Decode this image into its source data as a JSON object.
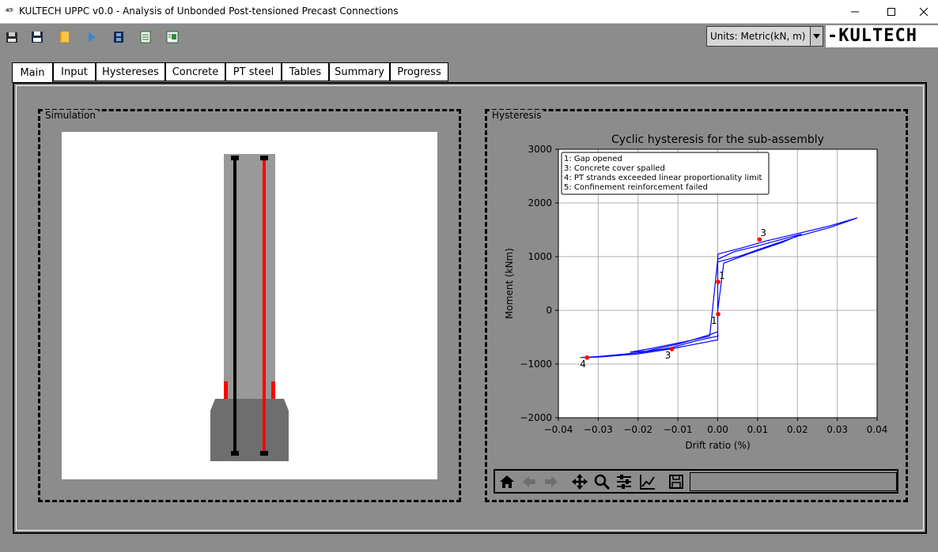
{
  "window": {
    "app_icon": "-KT-",
    "title": "KULTECH UPPC v0.0 - Analysis of Unbonded Post-tensioned Precast Connections",
    "controls": [
      "minimize-icon",
      "maximize-icon",
      "close-icon"
    ]
  },
  "toolbar": {
    "icons": [
      "new-icon",
      "save-icon",
      "open-folder-icon",
      "run-icon",
      "film-icon",
      "report-icon",
      "export-icon"
    ]
  },
  "units": {
    "label": "Units: Metric(kN, m)"
  },
  "logo": {
    "text": "-KULTECH"
  },
  "tabs": [
    {
      "label": "Main"
    },
    {
      "label": "Input"
    },
    {
      "label": "Hystereses"
    },
    {
      "label": "Concrete"
    },
    {
      "label": "PT steel"
    },
    {
      "label": "Tables"
    },
    {
      "label": "Summary"
    },
    {
      "label": "Progress"
    }
  ],
  "simulation": {
    "label": "Simulation",
    "colors": {
      "column": "#999999",
      "foundation": "#6e6e6e",
      "strand_black": "#000000",
      "strand_red": "#ff0000"
    }
  },
  "hysteresis": {
    "label": "Hysteresis"
  },
  "chart_data": {
    "type": "line",
    "title": "Cyclic hysteresis for the sub-assembly",
    "xlabel": "Drift ratio (%)",
    "ylabel": "Moment (kNm)",
    "xlim": [
      -0.04,
      0.04
    ],
    "ylim": [
      -2000,
      3000
    ],
    "xticks": [
      -0.04,
      -0.03,
      -0.02,
      -0.01,
      0.0,
      0.01,
      0.02,
      0.03,
      0.04
    ],
    "xtick_labels": [
      "−0.04",
      "−0.03",
      "−0.02",
      "−0.01",
      "0.00",
      "0.01",
      "0.02",
      "0.03",
      "0.04"
    ],
    "yticks": [
      -2000,
      -1000,
      0,
      1000,
      2000,
      3000
    ],
    "ytick_labels": [
      "−2000",
      "−1000",
      "0",
      "1000",
      "2000",
      "3000"
    ],
    "grid": true,
    "legend": {
      "placement": "top-left",
      "entries": [
        "1: Gap opened",
        "3: Concrete cover spalled",
        "4: PT strands exceeded linear proportionality limit",
        "5: Confinement reinforcement failed"
      ]
    },
    "series": [
      {
        "color": "#0000ff",
        "x": [
          0,
          0,
          0.0001,
          -0.005,
          -0.012,
          -0.02,
          -0.03,
          -0.0345,
          -0.03,
          -0.02,
          -0.012,
          -0.005,
          0,
          0,
          0.0001,
          0.006,
          0.012,
          0.02,
          0.028,
          0.035,
          0.028,
          0.02,
          0.012,
          0.006,
          0,
          0,
          -0.004,
          -0.01,
          -0.018,
          -0.022,
          -0.016,
          -0.008,
          -0.002,
          0,
          0.004,
          0.01,
          0.016,
          0.021,
          0.016,
          0.008,
          0.0015,
          0
        ]
      },
      {
        "color": "#0000ff",
        "y": [
          0,
          -450,
          -480,
          -560,
          -700,
          -790,
          -860,
          -880,
          -870,
          -810,
          -720,
          -620,
          -550,
          1000,
          1050,
          1160,
          1290,
          1430,
          1570,
          1720,
          1540,
          1380,
          1180,
          1020,
          900,
          -400,
          -500,
          -630,
          -760,
          -780,
          -700,
          -580,
          -480,
          950,
          1090,
          1200,
          1320,
          1420,
          1260,
          1060,
          880,
          0
        ]
      }
    ],
    "markers": [
      {
        "label": "1",
        "x": 0.0001,
        "y": -70
      },
      {
        "label": "1",
        "x": 0.0001,
        "y": 530
      },
      {
        "label": "3",
        "x": 0.0105,
        "y": 1320
      },
      {
        "label": "3",
        "x": -0.0115,
        "y": -720
      },
      {
        "label": "4",
        "x": -0.0328,
        "y": -880
      }
    ]
  },
  "nav_toolbar": {
    "icons": [
      "home-icon",
      "back-icon",
      "forward-icon",
      "pan-icon",
      "zoom-icon",
      "configure-subplots-icon",
      "edit-axis-icon",
      "save-figure-icon"
    ]
  }
}
